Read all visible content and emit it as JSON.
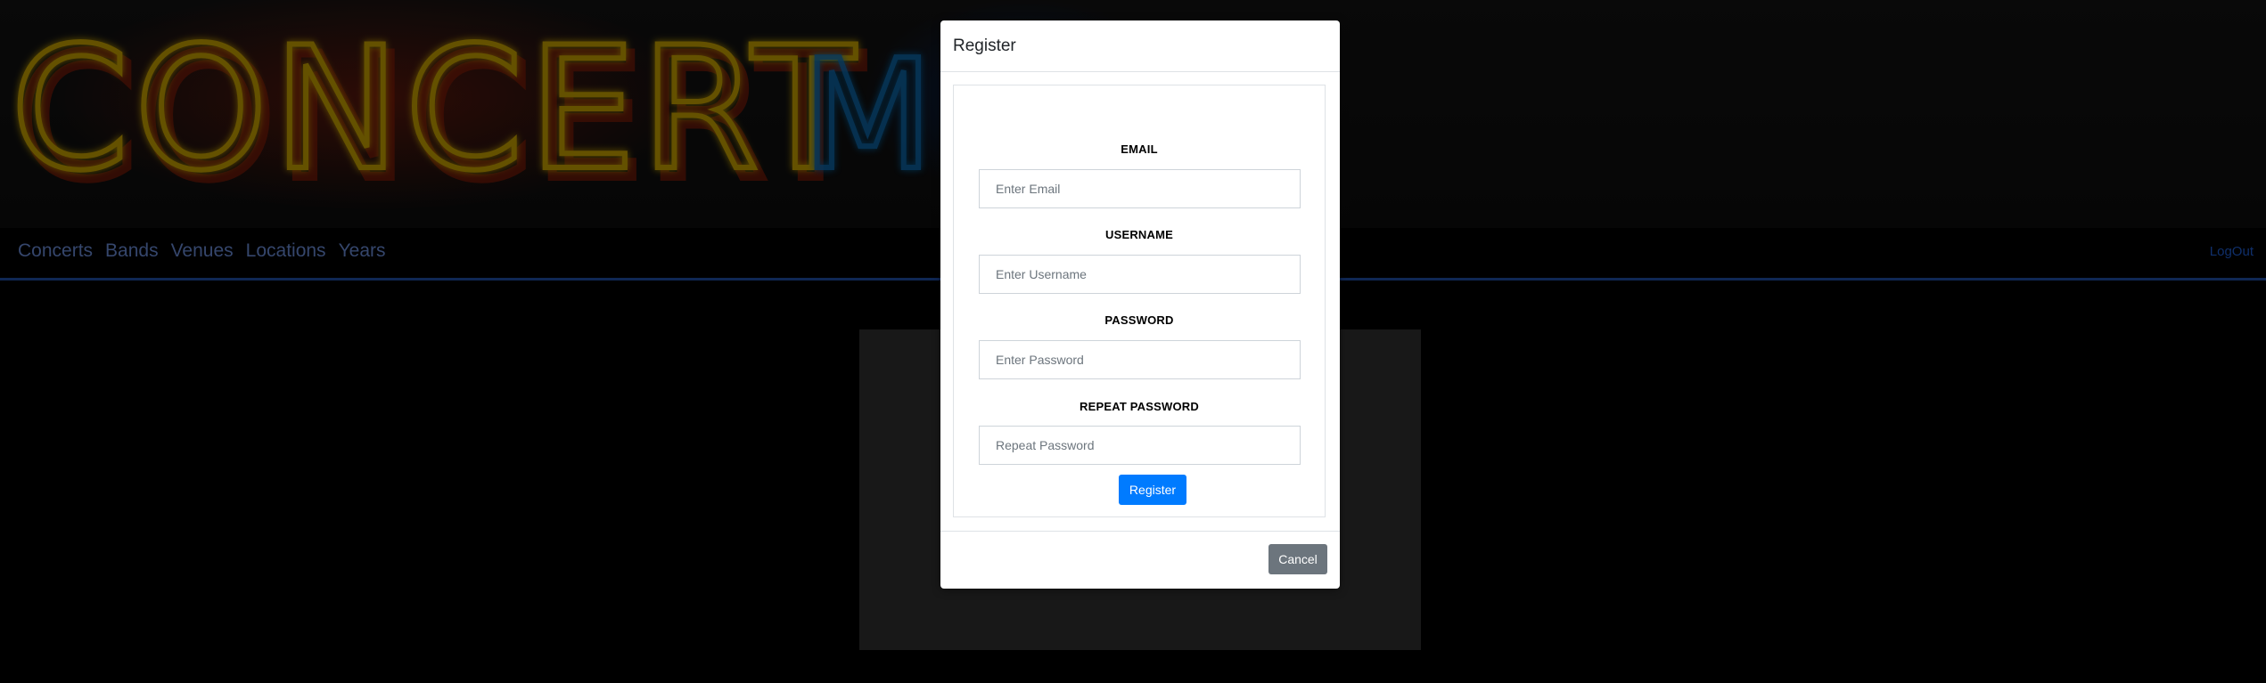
{
  "banner": {
    "logo_text": "CONCERT",
    "logo_text_2": "MUSE"
  },
  "nav": {
    "links": [
      "Concerts",
      "Bands",
      "Venues",
      "Locations",
      "Years"
    ],
    "logout_label": "LogOut"
  },
  "modal": {
    "title": "Register",
    "fields": {
      "email": {
        "label": "EMAIL",
        "placeholder": "Enter Email"
      },
      "username": {
        "label": "USERNAME",
        "placeholder": "Enter Username"
      },
      "password": {
        "label": "PASSWORD",
        "placeholder": "Enter Password"
      },
      "repeat_password": {
        "label": "REPEAT PASSWORD",
        "placeholder": "Repeat Password"
      }
    },
    "register_label": "Register",
    "cancel_label": "Cancel"
  },
  "colors": {
    "nav_link": "#6a8cd9",
    "nav_border": "#1f4fa8",
    "primary_button": "#007bff",
    "secondary_button": "#6c757d",
    "logo_neon_orange": "#c8a200",
    "logo_neon_blue": "#0a6fb8"
  }
}
